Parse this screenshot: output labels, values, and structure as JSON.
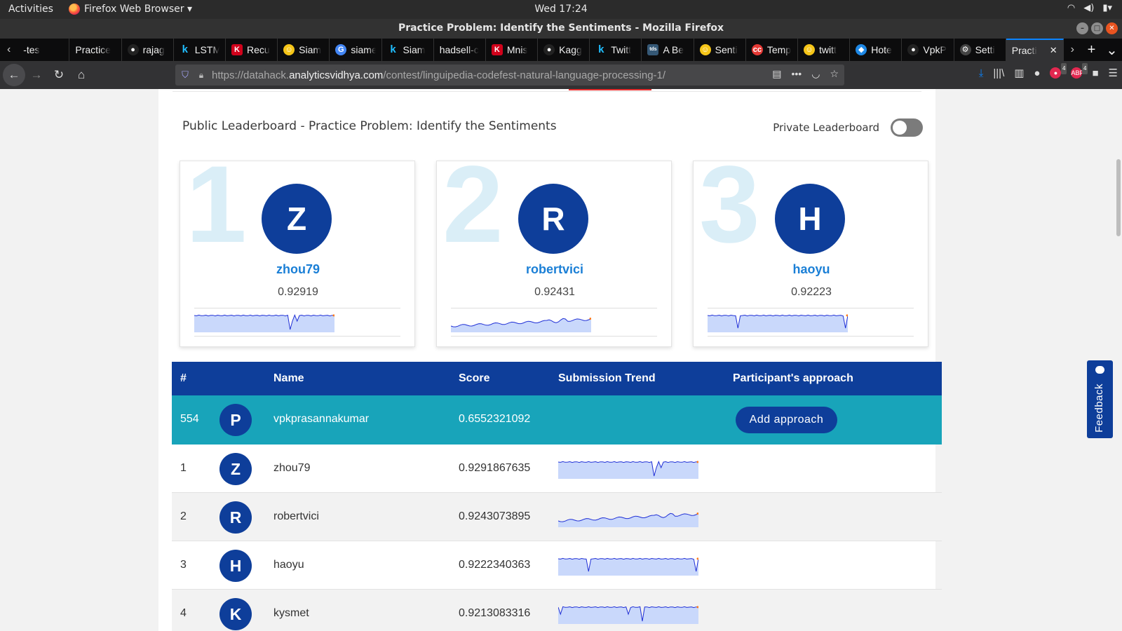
{
  "system": {
    "activities": "Activities",
    "app_name": "Firefox Web Browser ▾",
    "clock": "Wed 17:24"
  },
  "window": {
    "title": "Practice Problem: Identify the Sentiments - Mozilla Firefox"
  },
  "tabs": [
    {
      "label": "-tes",
      "icon": "none",
      "color": ""
    },
    {
      "label": "Practice",
      "icon": "none",
      "color": ""
    },
    {
      "label": "rajag",
      "icon": "github-icon",
      "color": "#222222"
    },
    {
      "label": "LSTM",
      "icon": "kaggle-icon",
      "color": "#20beff"
    },
    {
      "label": "Recu",
      "icon": "k-red-icon",
      "color": "#d0021b"
    },
    {
      "label": "Siam",
      "icon": "smiley-icon",
      "color": "#f5c518"
    },
    {
      "label": "siame",
      "icon": "google-icon",
      "color": "#4285f4"
    },
    {
      "label": "Siam",
      "icon": "kaggle-icon",
      "color": "#20beff"
    },
    {
      "label": "hadsell-c",
      "icon": "none",
      "color": ""
    },
    {
      "label": "Mnis",
      "icon": "k-red-icon",
      "color": "#d0021b"
    },
    {
      "label": "Kagg",
      "icon": "github-icon",
      "color": "#222222"
    },
    {
      "label": "Twitt",
      "icon": "kaggle-icon",
      "color": "#20beff"
    },
    {
      "label": "A Be",
      "icon": "tds-icon",
      "color": "#355876"
    },
    {
      "label": "Senti",
      "icon": "smiley-icon",
      "color": "#f5c518"
    },
    {
      "label": "Temp",
      "icon": "cc-icon",
      "color": "#e53935"
    },
    {
      "label": "twitt",
      "icon": "smiley-icon",
      "color": "#f5c518"
    },
    {
      "label": "Hote",
      "icon": "shield-icon",
      "color": "#1e88e5"
    },
    {
      "label": "VpkP",
      "icon": "github-icon",
      "color": "#222222"
    },
    {
      "label": "Setti",
      "icon": "gear-icon",
      "color": "#444444"
    },
    {
      "label": "Practi",
      "icon": "none",
      "color": "",
      "active": true
    }
  ],
  "urlbar": {
    "prefix": "https://datahack.",
    "domain": "analyticsvidhya.com",
    "path": "/contest/linguipedia-codefest-natural-language-processing-1/"
  },
  "extensions": {
    "badge_1": "4",
    "badge_2": "4"
  },
  "leaderboard": {
    "title": "Public Leaderboard - Practice Problem: Identify the Sentiments",
    "private_label": "Private Leaderboard",
    "private_enabled": false,
    "colors": {
      "brand": "#0e3e9a",
      "highlight": "#18a4ba",
      "link": "#1a7fd6",
      "rank_watermark": "#daeef7"
    },
    "top3": [
      {
        "rank": "1",
        "initial": "Z",
        "name": "zhou79",
        "score": "0.92919"
      },
      {
        "rank": "2",
        "initial": "R",
        "name": "robertvici",
        "score": "0.92431"
      },
      {
        "rank": "3",
        "initial": "H",
        "name": "haoyu",
        "score": "0.92223"
      }
    ],
    "headers": {
      "rank": "#",
      "name": "Name",
      "score": "Score",
      "trend": "Submission Trend",
      "approach": "Participant's approach"
    },
    "current_user": {
      "rank": "554",
      "initial": "P",
      "name": "vpkprasannakumar",
      "score": "0.6552321092",
      "action": "Add approach"
    },
    "rows": [
      {
        "rank": "1",
        "initial": "Z",
        "name": "zhou79",
        "score": "0.9291867635"
      },
      {
        "rank": "2",
        "initial": "R",
        "name": "robertvici",
        "score": "0.9243073895"
      },
      {
        "rank": "3",
        "initial": "H",
        "name": "haoyu",
        "score": "0.9222340363"
      },
      {
        "rank": "4",
        "initial": "K",
        "name": "kysmet",
        "score": "0.9213083316"
      }
    ]
  },
  "feedback": {
    "label": "Feedback"
  }
}
